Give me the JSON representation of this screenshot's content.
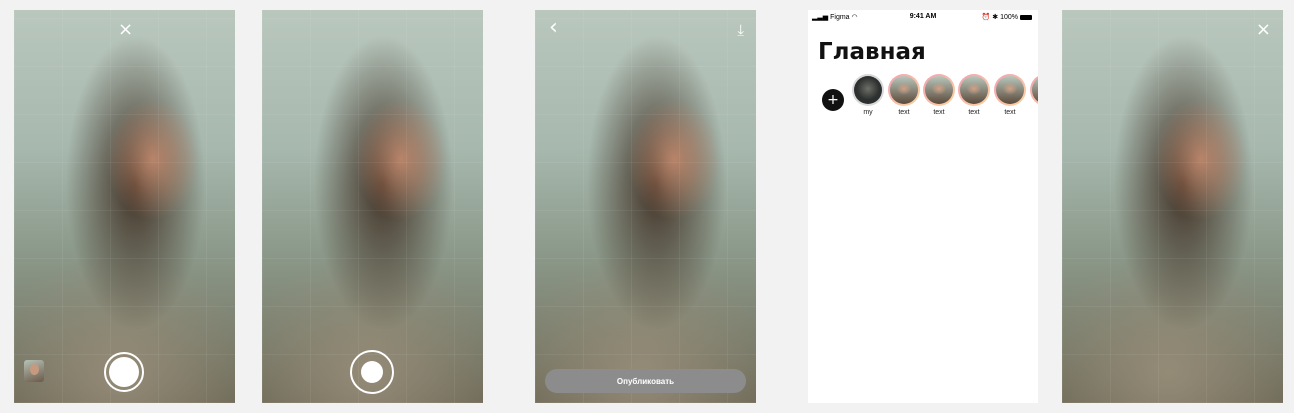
{
  "screens": {
    "camera1": {
      "close_icon": "×"
    },
    "camera2": {},
    "preview": {
      "back_icon": "‹",
      "download_icon": "⤓",
      "publish_label": "Опубликовать"
    },
    "feed": {
      "status": {
        "carrier": "Figma",
        "time": "9:41 AM",
        "battery": "100%"
      },
      "title": "Главная",
      "add_icon": "+",
      "stories": [
        {
          "label": "my"
        },
        {
          "label": "text"
        },
        {
          "label": "text"
        },
        {
          "label": "text"
        },
        {
          "label": "text"
        }
      ]
    },
    "final": {
      "close_icon": "×"
    }
  },
  "colors": {
    "background": "#f2f2f2",
    "publish_button": "#8c8c8c",
    "story_ring": "#f3a0b2"
  }
}
